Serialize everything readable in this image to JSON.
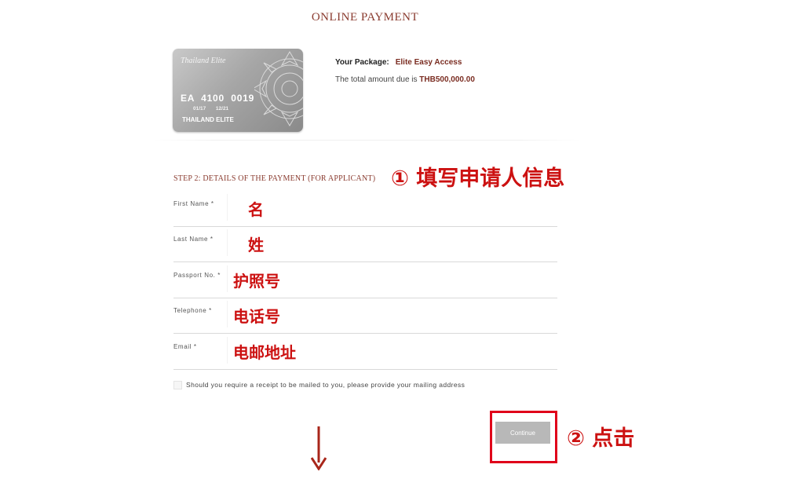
{
  "page": {
    "title": "ONLINE PAYMENT"
  },
  "card": {
    "brand": "Thailand Elite",
    "number": "EA  4100  0019",
    "dates": "01/17       12/21",
    "holder": "THAILAND ELITE"
  },
  "package": {
    "label": "Your Package:",
    "name": "Elite Easy Access",
    "amount_text": "The total amount due is",
    "amount": "THB500,000.00"
  },
  "step": {
    "heading": "STEP 2: DETAILS OF THE PAYMENT (FOR  APPLICANT)"
  },
  "fields": [
    {
      "label": "First Name *",
      "note": "名"
    },
    {
      "label": "Last Name *",
      "note": "姓"
    },
    {
      "label": "Passport No. *",
      "note": "护照号"
    },
    {
      "label": "Telephone *",
      "note": "电话号"
    },
    {
      "label": "Email *",
      "note": "电邮地址"
    }
  ],
  "receipt": {
    "text": "Should you require a receipt to be mailed to you, please provide your mailing address"
  },
  "continue_label": "Continue",
  "annotations": {
    "step1": "① 填写申请人信息",
    "step2": "② 点击"
  },
  "colors": {
    "accent": "#8a3b2f",
    "annotation": "#cc1111",
    "frame": "#e0001a",
    "button": "#b8b8b8"
  }
}
